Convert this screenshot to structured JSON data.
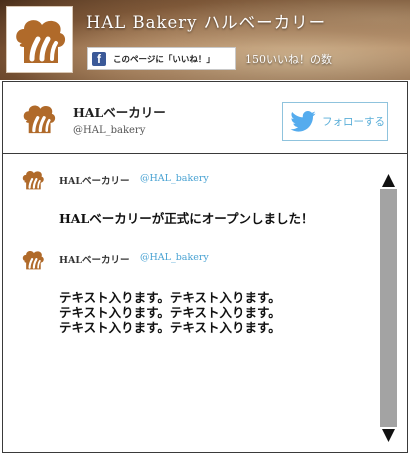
{
  "header": {
    "site_title": "HAL Bakery ハルベーカリー",
    "facebook_like_label": "このページに「いいね！」",
    "like_count": "150いいね！の数"
  },
  "profile": {
    "name": "HALベーカリー",
    "handle": "@HAL_bakery",
    "follow_label": "フォローする"
  },
  "tweets": [
    {
      "author": "HALベーカリー",
      "handle": "@HAL_bakery",
      "text": "HALベーカリーが正式にオープンしました！"
    },
    {
      "author": "HALベーカリー",
      "handle": "@HAL_bakery",
      "text": "テキスト入ります。テキスト入ります。\nテキスト入ります。テキスト入ります。\nテキスト入ります。テキスト入ります。"
    }
  ],
  "colors": {
    "logo_brown": "#b06a2a",
    "facebook_blue": "#3b5998",
    "twitter_blue": "#55acee",
    "link_blue": "#4aa3d3",
    "scroll_thumb": "#a3a3a3"
  },
  "icons": {
    "logo": "bakery-chef-hat-icon",
    "facebook": "facebook-icon",
    "twitter": "twitter-bird-icon",
    "scroll_up": "triangle-up-icon",
    "scroll_down": "triangle-down-icon"
  }
}
